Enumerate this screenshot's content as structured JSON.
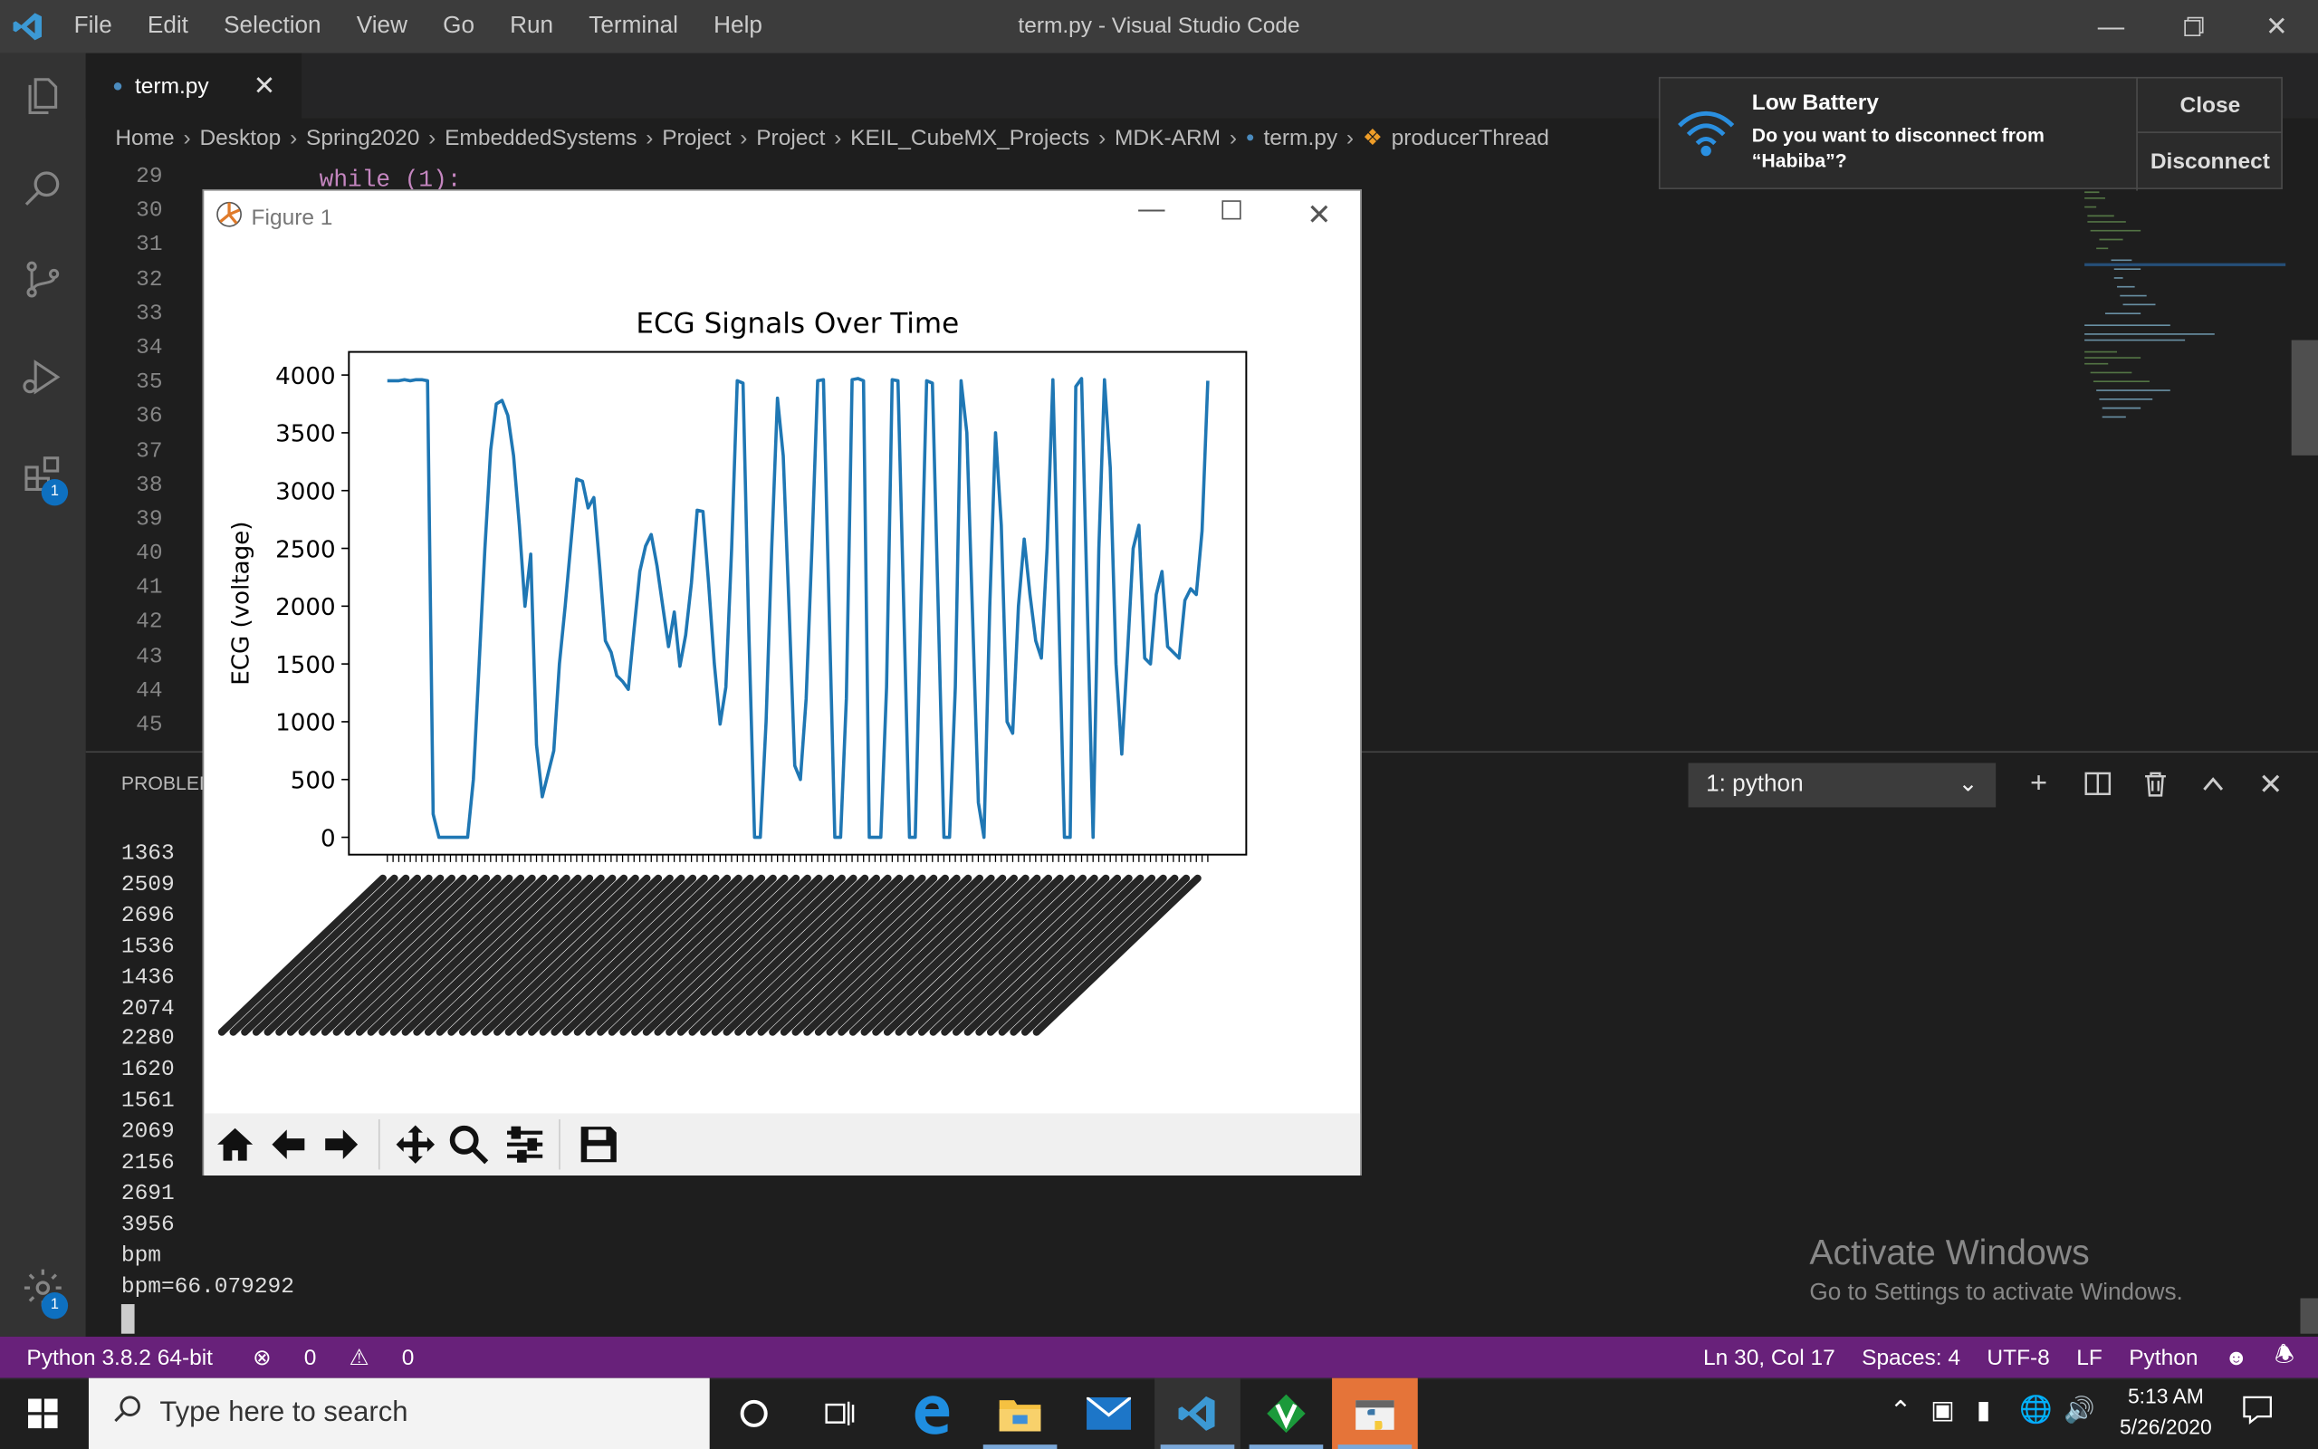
{
  "window": {
    "title": "term.py - Visual Studio Code"
  },
  "menu": [
    "File",
    "Edit",
    "Selection",
    "View",
    "Go",
    "Run",
    "Terminal",
    "Help"
  ],
  "activity_badges": {
    "extensions": "1",
    "settings": "1"
  },
  "tabs": [
    {
      "label": "term.py"
    }
  ],
  "breadcrumb": [
    "Home",
    "Desktop",
    "Spring2020",
    "EmbeddedSystems",
    "Project",
    "Project",
    "KEIL_CubeMX_Projects",
    "MDK-ARM",
    "term.py",
    "producerThread"
  ],
  "editor": {
    "line_numbers": [
      "29",
      "30",
      "31",
      "32",
      "33",
      "34",
      "35",
      "36",
      "37",
      "38",
      "39",
      "40",
      "41",
      "42",
      "43",
      "44",
      "45"
    ],
    "visible_code": "while (1):"
  },
  "notification": {
    "title": "Low Battery",
    "message": "Do you want to disconnect from “Habiba”?",
    "close_label": "Close",
    "disconnect_label": "Disconnect"
  },
  "panel": {
    "title": "PROBLEM",
    "terminal_select": "1: python",
    "output_lines": [
      "1363",
      "2509",
      "2696",
      "1536",
      "1436",
      "2074",
      "2280",
      "1620",
      "1561",
      "2069",
      "2156",
      "2691",
      "3956",
      "bpm",
      "bpm=66.079292"
    ]
  },
  "watermark": {
    "title": "Activate Windows",
    "subtitle": "Go to Settings to activate Windows."
  },
  "status": {
    "interpreter": "Python 3.8.2 64-bit",
    "errors": "0",
    "warnings": "0",
    "position": "Ln 30, Col 17",
    "spaces": "Spaces: 4",
    "encoding": "UTF-8",
    "eol": "LF",
    "language": "Python"
  },
  "taskbar": {
    "search_placeholder": "Type here to search",
    "time": "5:13 AM",
    "date": "5/26/2020"
  },
  "figure": {
    "title": "Figure 1"
  },
  "chart_data": {
    "type": "line",
    "title": "ECG Signals Over Time",
    "xlabel": "",
    "ylabel": "ECG (voltage)",
    "ylim": [
      -150,
      4200
    ],
    "yticks": [
      0,
      500,
      1000,
      1500,
      2000,
      2500,
      3000,
      3500,
      4000
    ],
    "grid": false,
    "color": "#1f77b4",
    "series": [
      {
        "values": [
          3950,
          3950,
          3950,
          3960,
          3950,
          3960,
          3960,
          3950,
          200,
          0,
          0,
          0,
          0,
          0,
          0,
          500,
          1500,
          2500,
          3350,
          3750,
          3780,
          3650,
          3300,
          2700,
          2000,
          2450,
          800,
          350,
          550,
          750,
          1500,
          2000,
          2550,
          3100,
          3080,
          2850,
          2940,
          2350,
          1700,
          1600,
          1400,
          1350,
          1280,
          1800,
          2300,
          2520,
          2620,
          2350,
          2000,
          1650,
          1950,
          1480,
          1750,
          2200,
          2830,
          2820,
          2200,
          1500,
          980,
          1300,
          2500,
          3950,
          3930,
          1800,
          0,
          0,
          1000,
          2500,
          3800,
          3300,
          2000,
          620,
          500,
          1200,
          2500,
          3950,
          3960,
          2000,
          0,
          0,
          1200,
          3960,
          3970,
          3950,
          0,
          0,
          0,
          1300,
          3960,
          3950,
          2000,
          0,
          0,
          2000,
          3950,
          3930,
          2000,
          0,
          0,
          1300,
          3950,
          3500,
          1900,
          300,
          0,
          2000,
          3500,
          2700,
          1000,
          900,
          2000,
          2580,
          2100,
          1700,
          1550,
          2500,
          3960,
          2000,
          0,
          0,
          3900,
          3970,
          2000,
          0,
          2500,
          3960,
          3200,
          1500,
          720,
          1600,
          2500,
          2700,
          1550,
          1500,
          2100,
          2300,
          1650,
          1600,
          1550,
          2050,
          2150,
          2100,
          2650,
          3950
        ]
      }
    ]
  }
}
